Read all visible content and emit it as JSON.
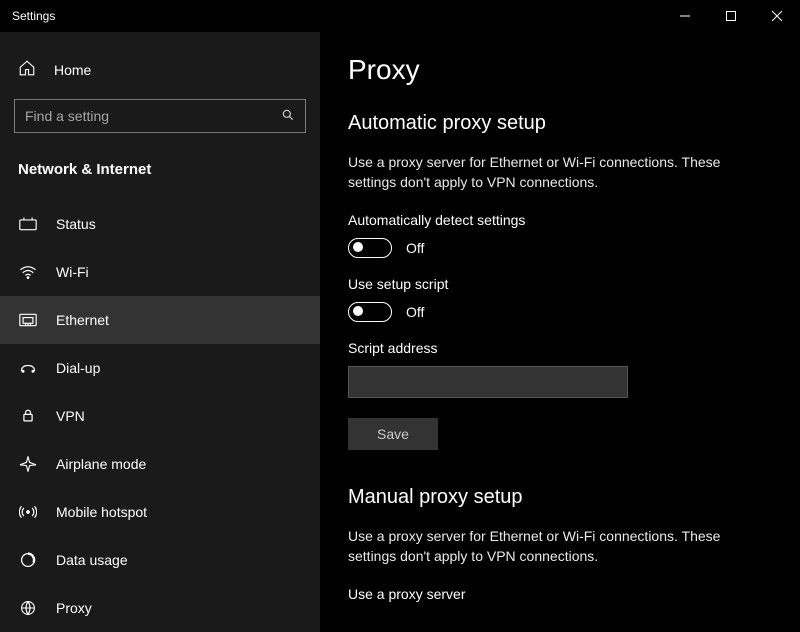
{
  "window_title": "Settings",
  "sidebar": {
    "home_label": "Home",
    "search_placeholder": "Find a setting",
    "category_label": "Network & Internet",
    "items": [
      {
        "label": "Status"
      },
      {
        "label": "Wi-Fi"
      },
      {
        "label": "Ethernet"
      },
      {
        "label": "Dial-up"
      },
      {
        "label": "VPN"
      },
      {
        "label": "Airplane mode"
      },
      {
        "label": "Mobile hotspot"
      },
      {
        "label": "Data usage"
      },
      {
        "label": "Proxy"
      }
    ]
  },
  "content": {
    "page_title": "Proxy",
    "auto": {
      "heading": "Automatic proxy setup",
      "description": "Use a proxy server for Ethernet or Wi-Fi connections. These settings don't apply to VPN connections.",
      "detect_label": "Automatically detect settings",
      "detect_state": "Off",
      "script_toggle_label": "Use setup script",
      "script_toggle_state": "Off",
      "script_address_label": "Script address",
      "script_address_value": "",
      "save_label": "Save"
    },
    "manual": {
      "heading": "Manual proxy setup",
      "description": "Use a proxy server for Ethernet or Wi-Fi connections. These settings don't apply to VPN connections.",
      "use_proxy_label": "Use a proxy server"
    }
  }
}
